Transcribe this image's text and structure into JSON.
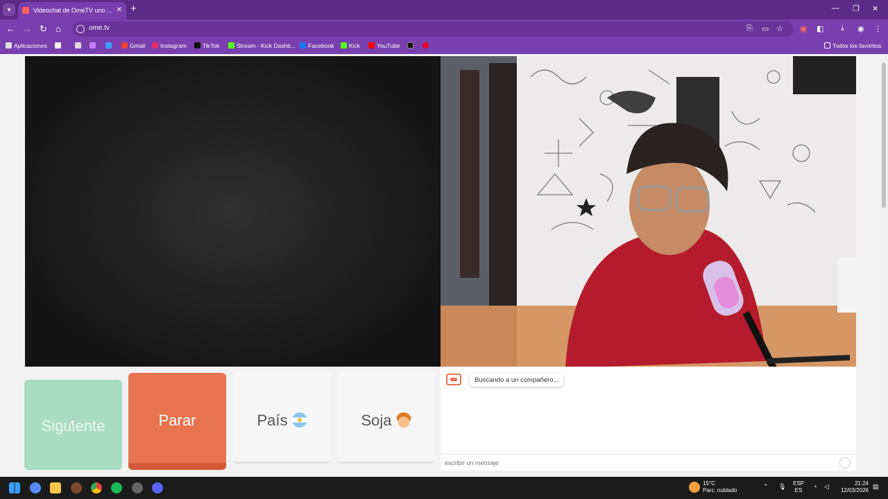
{
  "browser": {
    "tab_title": "Videochat de OmeTV uno ...",
    "url": "ome.tv",
    "bookmarks": [
      {
        "label": "Aplicaciones",
        "color": "#e0e0e0"
      },
      {
        "label": "Gmail",
        "color": "#ea4335"
      },
      {
        "label": "Instagram",
        "color": "#e1306c"
      },
      {
        "label": "TikTok",
        "color": "#111111"
      },
      {
        "label": "Stream - Kick Dashb...",
        "color": "#53fc18"
      },
      {
        "label": "Facebook",
        "color": "#1877f2"
      },
      {
        "label": "Kick",
        "color": "#53fc18"
      },
      {
        "label": "YouTube",
        "color": "#ff0000"
      }
    ],
    "all_bookmarks_label": "Todos los favoritos"
  },
  "controls": {
    "next_label": "Siguiente",
    "stop_label": "Parar",
    "country_label": "País",
    "gender_label": "Soja"
  },
  "chat": {
    "status_message": "Buscando a un compañero...",
    "input_placeholder": "escribir un mensaje"
  },
  "taskbar": {
    "weather_temp": "15°C",
    "weather_desc": "Parc. nublado",
    "lang_line1": "ESP",
    "lang_line2": "ES",
    "time": "21:24",
    "date": "12/03/2026"
  },
  "colors": {
    "chrome_purple": "#7a3fae",
    "next_green": "#a8dcc3",
    "stop_orange": "#e8734f"
  }
}
